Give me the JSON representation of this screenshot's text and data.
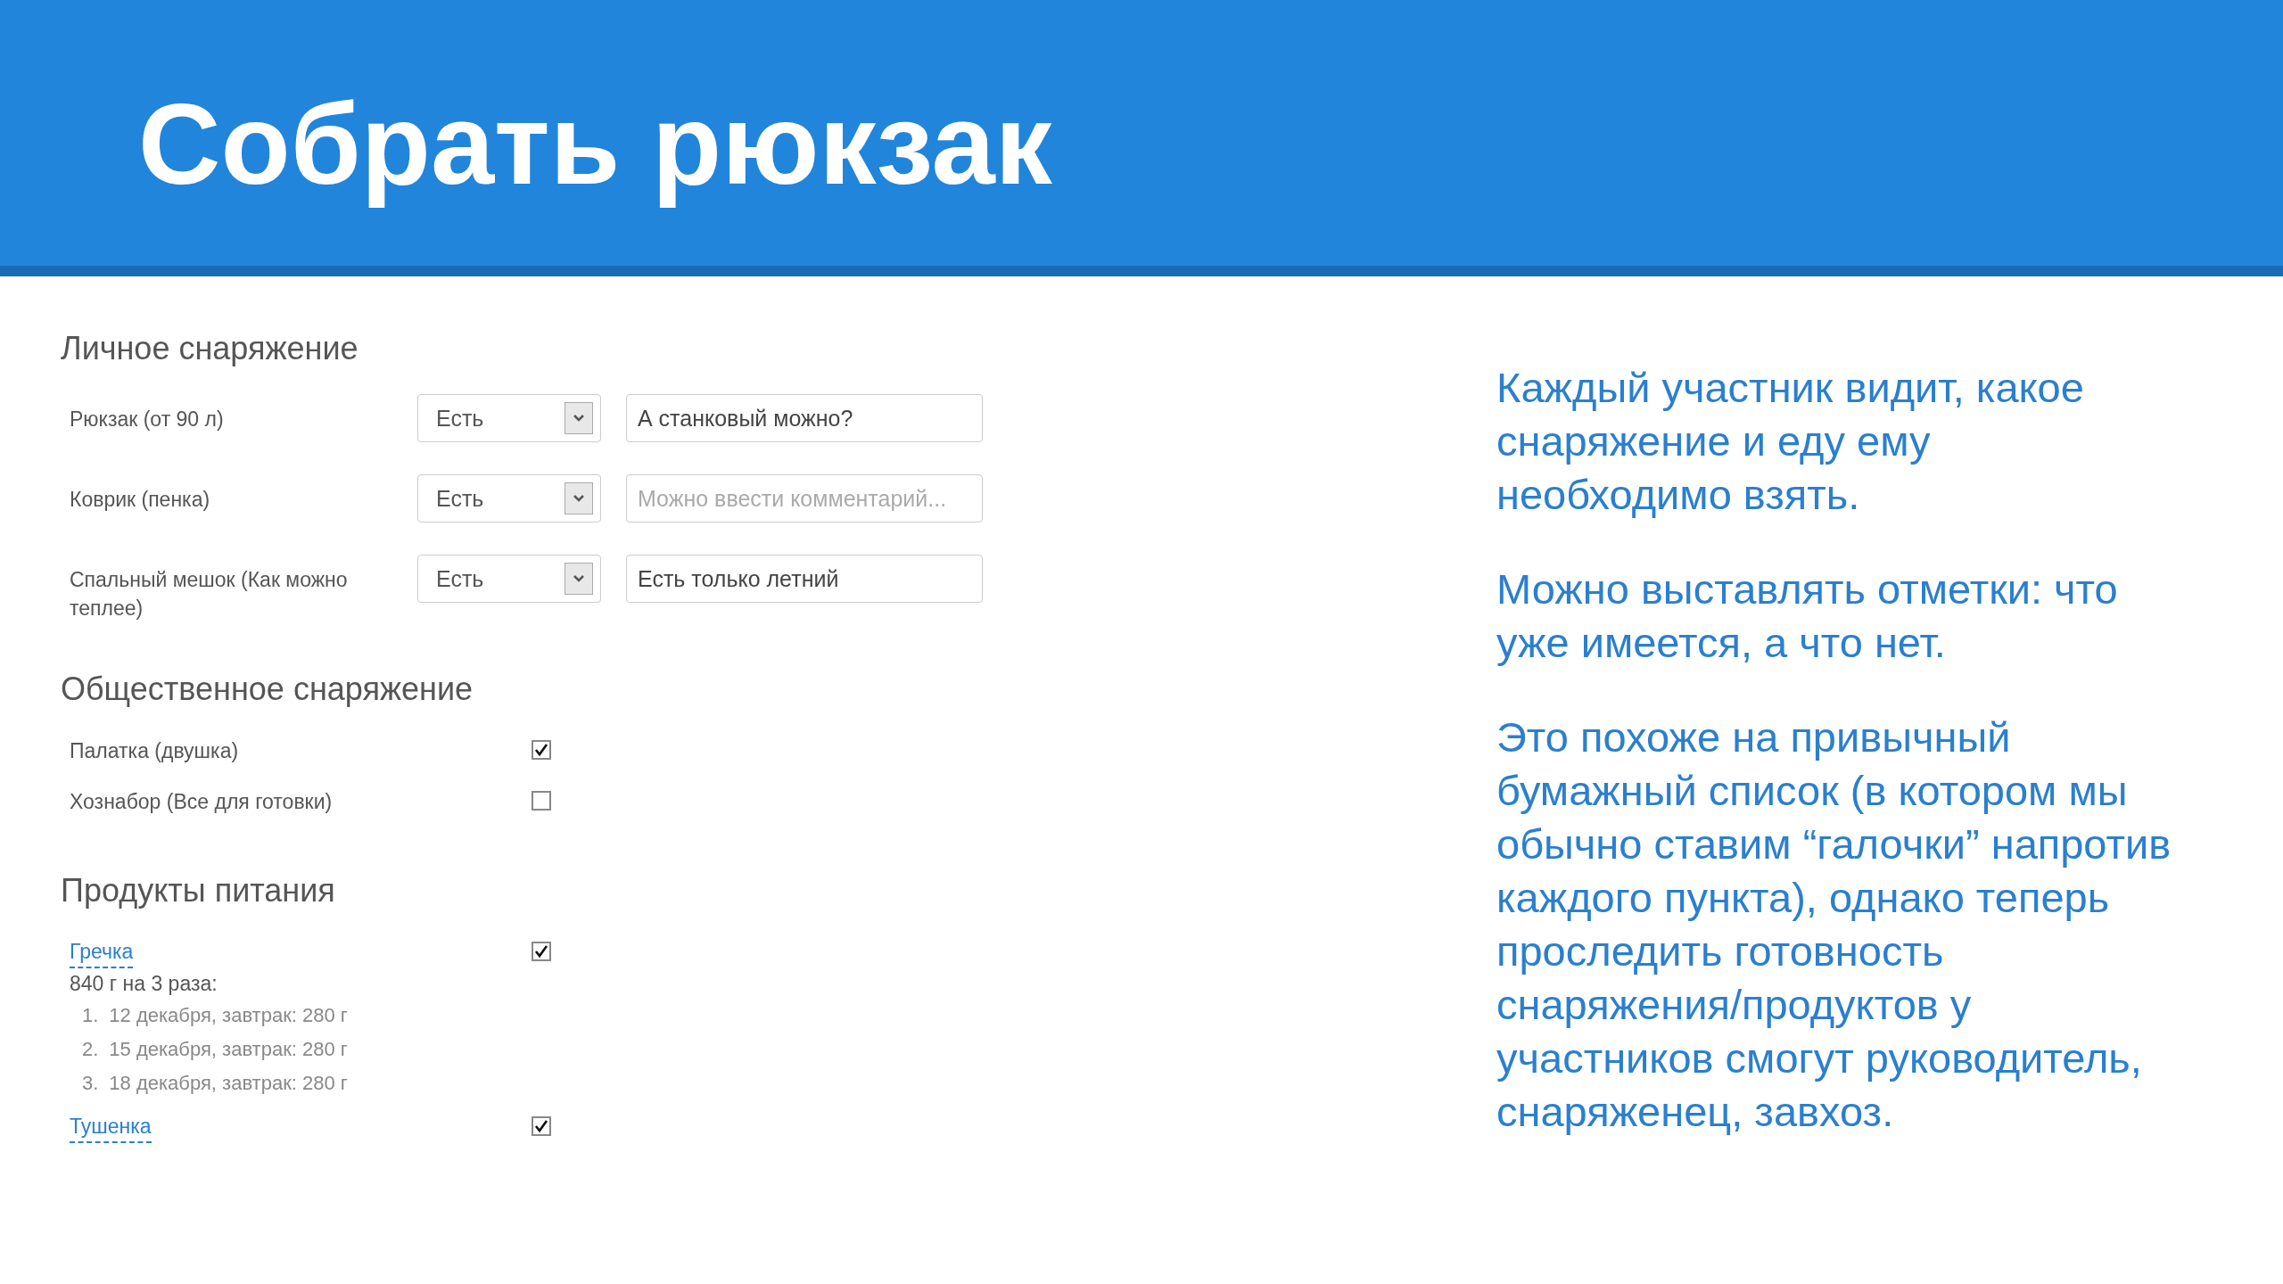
{
  "slide": {
    "title": "Собрать рюкзак"
  },
  "personal_gear": {
    "heading": "Личное снаряжение",
    "rows": [
      {
        "label": "Рюкзак (от 90 л)",
        "select_value": "Есть",
        "comment": {
          "value": "А станковый можно?"
        }
      },
      {
        "label": "Коврик (пенка)",
        "select_value": "Есть",
        "comment": {
          "placeholder": "Можно ввести комментарий..."
        }
      },
      {
        "label": "Спальный мешок (Как можно теплее)",
        "select_value": "Есть",
        "comment": {
          "value": "Есть только летний"
        }
      }
    ]
  },
  "group_gear": {
    "heading": "Общественное снаряжение",
    "rows": [
      {
        "label": "Палатка (двушка)",
        "checked": true
      },
      {
        "label": "Хознабор (Все для готовки)",
        "checked": false
      }
    ]
  },
  "food": {
    "heading": "Продукты питания",
    "rows": [
      {
        "name": "Гречка",
        "checked": true,
        "summary": "840 г на 3 раза:",
        "portions": [
          {
            "number": "1.",
            "text": "12 декабря, завтрак: 280 г"
          },
          {
            "number": "2.",
            "text": "15 декабря, завтрак: 280 г"
          },
          {
            "number": "3.",
            "text": "18 декабря, завтрак: 280 г"
          }
        ]
      },
      {
        "name": "Тушенка",
        "checked": true
      }
    ]
  },
  "notes": [
    "Каждый участник видит, какое снаряжение и еду ему необходимо взять.",
    "Можно выставлять отметки: что уже имеется, а что нет.",
    "Это похоже на привычный бумажный список (в котором мы обычно ставим “галочки” напротив каждого пункта), однако теперь проследить готовность снаряжения/продуктов у участников смогут руководитель, снаряженец, завхоз."
  ]
}
